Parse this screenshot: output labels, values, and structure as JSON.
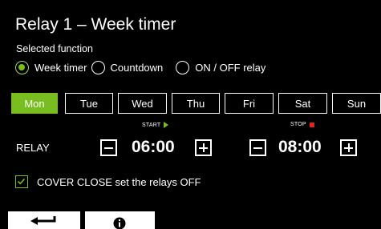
{
  "screen": {
    "title": "Relay 1 – Week timer",
    "subtitle": "Selected function"
  },
  "functions": {
    "selected": "Week timer",
    "options": [
      "Week timer",
      "Countdown",
      "ON / OFF relay"
    ]
  },
  "days": {
    "selected": "Mon",
    "items": [
      "Mon",
      "Tue",
      "Wed",
      "Thu",
      "Fri",
      "Sat",
      "Sun"
    ]
  },
  "schedule": {
    "start_label": "START",
    "stop_label": "STOP",
    "row_label": "RELAY",
    "start_time": "06:00",
    "stop_time": "08:00"
  },
  "cover": {
    "checked": true,
    "label": "COVER CLOSE set the relays OFF"
  },
  "footer": {
    "back_icon": "back-arrow-icon",
    "info_icon": "info-icon"
  },
  "colors": {
    "accent": "#78be20",
    "background": "#000000",
    "start_indicator": "#78be20",
    "stop_indicator": "#e1251b"
  }
}
